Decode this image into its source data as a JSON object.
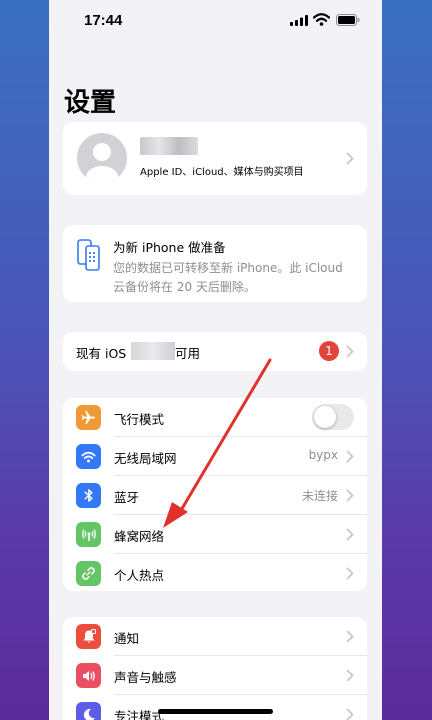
{
  "status": {
    "time": "17:44"
  },
  "page_title": "设置",
  "account": {
    "subtitle": "Apple ID、iCloud、媒体与购买项目"
  },
  "prepare": {
    "title": "为新 iPhone 做准备",
    "body": "您的数据已可转移至新 iPhone。此 iCloud 云备份将在 20 天后删除。"
  },
  "update": {
    "label_prefix": "现有 iOS",
    "label_suffix": "可用",
    "badge": "1"
  },
  "network": [
    {
      "label": "飞行模式",
      "icon": "airplane-icon",
      "color": "#f09a37",
      "type": "toggle",
      "on": false
    },
    {
      "label": "无线局域网",
      "icon": "wifi-icon",
      "color": "#3478f6",
      "value": "bypx"
    },
    {
      "label": "蓝牙",
      "icon": "bluetooth-icon",
      "color": "#3478f6",
      "value": "未连接"
    },
    {
      "label": "蜂窝网络",
      "icon": "antenna-icon",
      "color": "#65c466",
      "value": ""
    },
    {
      "label": "个人热点",
      "icon": "hotspot-icon",
      "color": "#65c466",
      "value": ""
    }
  ],
  "notifications": [
    {
      "label": "通知",
      "icon": "bell-icon",
      "color": "#eb4e3d"
    },
    {
      "label": "声音与触感",
      "icon": "speaker-icon",
      "color": "#eb4e62"
    },
    {
      "label": "专注模式",
      "icon": "moon-icon",
      "color": "#5e5ce6"
    }
  ],
  "annotation": {
    "arrow_color": "#e0322a"
  }
}
